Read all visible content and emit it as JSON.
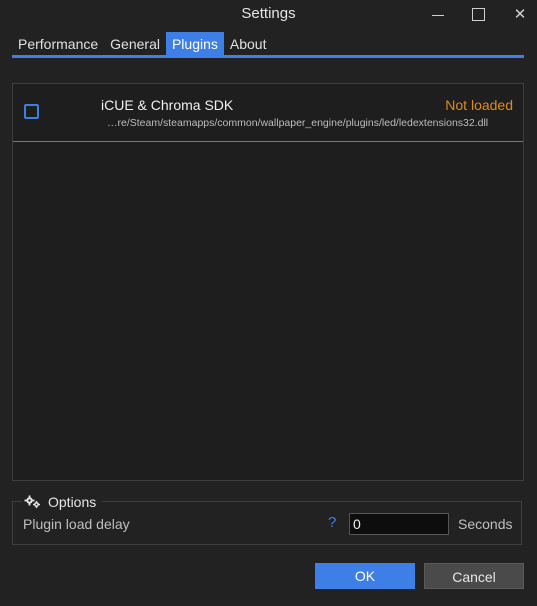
{
  "window": {
    "title": "Settings",
    "controls": [
      "minimize-icon",
      "maximize-icon",
      "close-icon"
    ]
  },
  "tabs": [
    {
      "label": "Performance",
      "active": false
    },
    {
      "label": "General",
      "active": false
    },
    {
      "label": "Plugins",
      "active": true
    },
    {
      "label": "About",
      "active": false
    }
  ],
  "plugins": [
    {
      "name": "iCUE & Chroma SDK",
      "status": "Not loaded",
      "path": "…re/Steam/steamapps/common/wallpaper_engine/plugins/led/ledextensions32.dll",
      "checked": false
    }
  ],
  "options": {
    "title": "Options",
    "icon": "gears-icon",
    "delay_label": "Plugin load delay",
    "help": "?",
    "delay_value": "0",
    "unit": "Seconds"
  },
  "buttons": {
    "ok": "OK",
    "cancel": "Cancel"
  },
  "colors": {
    "accent": "#3d7fe6",
    "warning": "#e08a1e",
    "background": "#222222"
  }
}
